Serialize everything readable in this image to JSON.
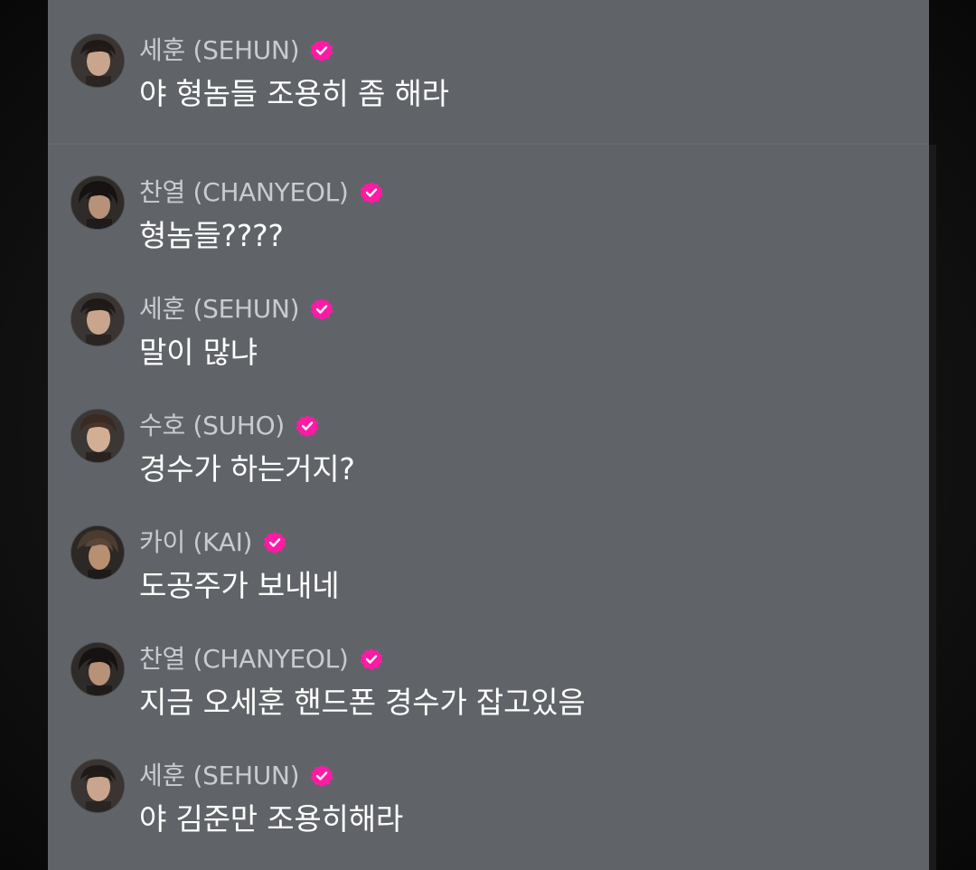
{
  "colors": {
    "panel_bg": "#606469",
    "name_text": "#c9cbce",
    "message_text": "#ffffff",
    "verified_badge": "#ff1aa6"
  },
  "messages": [
    {
      "name": "세훈 (SEHUN)",
      "text": "야 형놈들 조용히 좀 해라",
      "avatar": "sehun-avatar",
      "verified_icon": "verified-check-icon"
    },
    {
      "name": "찬열 (CHANYEOL)",
      "text": "형놈들????",
      "avatar": "chanyeol-avatar",
      "verified_icon": "verified-check-icon"
    },
    {
      "name": "세훈 (SEHUN)",
      "text": "말이 많냐",
      "avatar": "sehun-avatar",
      "verified_icon": "verified-check-icon"
    },
    {
      "name": "수호 (SUHO)",
      "text": "경수가 하는거지?",
      "avatar": "suho-avatar",
      "verified_icon": "verified-check-icon"
    },
    {
      "name": "카이 (KAI)",
      "text": "도공주가 보내네",
      "avatar": "kai-avatar",
      "verified_icon": "verified-check-icon"
    },
    {
      "name": "찬열 (CHANYEOL)",
      "text": "지금 오세훈 핸드폰 경수가 잡고있음",
      "avatar": "chanyeol-avatar",
      "verified_icon": "verified-check-icon"
    },
    {
      "name": "세훈 (SEHUN)",
      "text": "야 김준만 조용히해라",
      "avatar": "sehun-avatar",
      "verified_icon": "verified-check-icon"
    }
  ]
}
